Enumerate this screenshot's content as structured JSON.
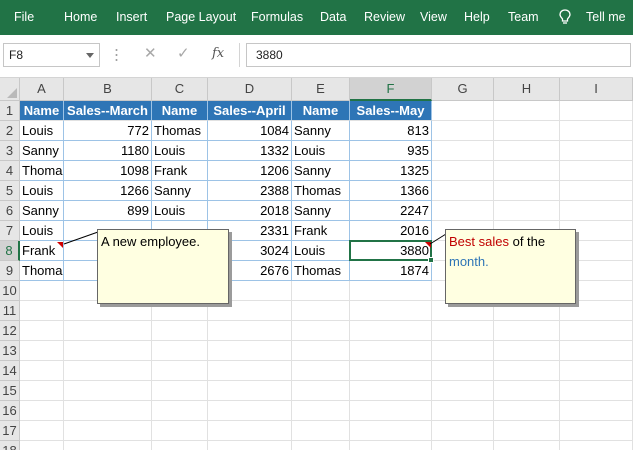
{
  "ribbon": {
    "tabs": [
      "File",
      "Home",
      "Insert",
      "Page Layout",
      "Formulas",
      "Data",
      "Review",
      "View",
      "Help",
      "Team"
    ],
    "tell_me": "Tell me",
    "bg_color": "#217346"
  },
  "formula_bar": {
    "name_box": "F8",
    "formula": "3880",
    "icons": [
      "cancel-icon",
      "enter-icon",
      "function-icon"
    ],
    "fx_label": "fx"
  },
  "columns": [
    "A",
    "B",
    "C",
    "D",
    "E",
    "F",
    "G",
    "H",
    "I"
  ],
  "rows": [
    "1",
    "2",
    "3",
    "4",
    "5",
    "6",
    "7",
    "8",
    "9",
    "10",
    "11",
    "12",
    "13",
    "14",
    "15",
    "16",
    "17",
    "18"
  ],
  "selected_cell": {
    "column": "F",
    "row": "8"
  },
  "table": {
    "header_color": "#2e75b6",
    "headers": [
      "Name",
      "Sales--March",
      "Name",
      "Sales--April",
      "Name",
      "Sales--May"
    ],
    "data": [
      [
        "Louis",
        "772",
        "Thomas",
        "1084",
        "Sanny",
        "813"
      ],
      [
        "Sanny",
        "1180",
        "Louis",
        "1332",
        "Louis",
        "935"
      ],
      [
        "Thoma",
        "1098",
        "Frank",
        "1206",
        "Sanny",
        "1325"
      ],
      [
        "Louis",
        "1266",
        "Sanny",
        "2388",
        "Thomas",
        "1366"
      ],
      [
        "Sanny",
        "899",
        "Louis",
        "2018",
        "Sanny",
        "2247"
      ],
      [
        "Louis",
        "",
        "",
        "2331",
        "Frank",
        "2016"
      ],
      [
        "Frank",
        "",
        "",
        "3024",
        "Louis",
        "3880"
      ],
      [
        "Thoma",
        "",
        "",
        "2676",
        "Thomas",
        "1874"
      ]
    ]
  },
  "comments": {
    "a8": {
      "text": "A new employee."
    },
    "f8": {
      "part1": "Best sales",
      "part2": " of the",
      "part3": "month.",
      "color_red": "#c00000",
      "color_blue": "#2e75b6"
    }
  }
}
